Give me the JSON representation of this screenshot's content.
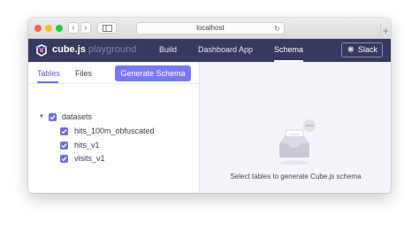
{
  "browser": {
    "url": "localhost",
    "new_tab_symbol": "+"
  },
  "app": {
    "brand": "cube.js",
    "brand_sub": "playground",
    "nav": [
      {
        "label": "Build"
      },
      {
        "label": "Dashboard App"
      },
      {
        "label": "Schema",
        "active": true
      }
    ],
    "slack_label": "Slack"
  },
  "left_panel": {
    "tabs": [
      {
        "label": "Tables",
        "active": true
      },
      {
        "label": "Files"
      }
    ],
    "generate_button": "Generate Schema",
    "tree": {
      "root": {
        "label": "datasets",
        "checked": true,
        "expanded": true
      },
      "children": [
        {
          "label": "hits_100m_obfuscated",
          "checked": true
        },
        {
          "label": "hits_v1",
          "checked": true
        },
        {
          "label": "visits_v1",
          "checked": true
        }
      ]
    }
  },
  "right_panel": {
    "empty_message": "Select tables to generate Cube.js schema"
  },
  "colors": {
    "header_bg": "#383961",
    "accent": "#7a77f5",
    "checkbox": "#6c6fe0",
    "right_bg": "#f4f4fa"
  }
}
